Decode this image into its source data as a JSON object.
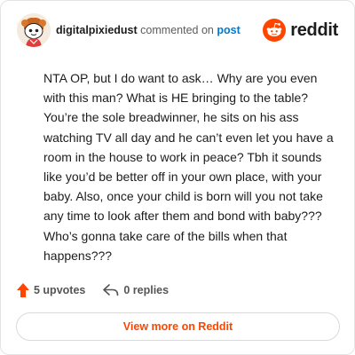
{
  "header": {
    "username": "digitalpixiedust",
    "action_text": "commented on",
    "post_link": "post",
    "brand": "reddit",
    "avatar_icon": "snoo-avatar-icon",
    "logo_icon": "reddit-snoo-icon"
  },
  "comment": {
    "body": "NTA OP, but I do want to ask… Why are you even with this man? What is HE bringing to the table? You’re the sole breadwinner, he sits on his ass watching TV all day and he can’t even let you have a room in the house to work in peace? Tbh it sounds like you’d be better off in your own place, with your baby. Also, once your child is born will you not take any time to look after them and bond with baby??? Who’s gonna take care of the bills when that happens???"
  },
  "stats": {
    "upvotes": "5 upvotes",
    "replies": "0 replies",
    "upvote_icon": "upvote-arrow-icon",
    "reply_icon": "reply-arrow-icon"
  },
  "cta": {
    "label": "View more on Reddit"
  },
  "colors": {
    "brand_orange": "#ff4500",
    "link_blue": "#0079d3",
    "text": "#1c1c1c",
    "muted": "#555555"
  }
}
